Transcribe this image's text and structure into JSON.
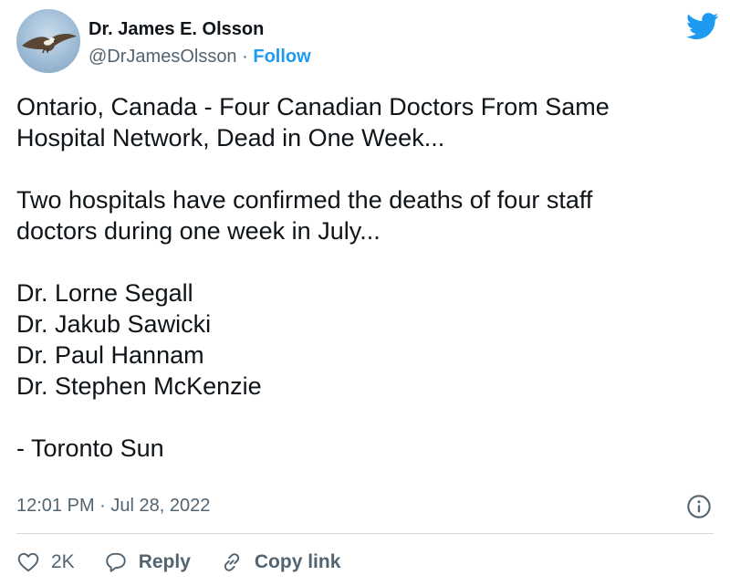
{
  "author": {
    "display_name": "Dr. James E. Olsson",
    "handle": "@DrJamesOlsson",
    "separator": "·",
    "follow_label": "Follow"
  },
  "tweet": {
    "lines": [
      "Ontario, Canada - Four Canadian Doctors From Same",
      "Hospital Network, Dead in One Week...",
      "Two hospitals have confirmed the deaths of four staff",
      "doctors during one week in July...",
      "Dr. Lorne Segall",
      "Dr. Jakub Sawicki",
      "Dr. Paul Hannam",
      "Dr. Stephen McKenzie",
      "- Toronto Sun"
    ]
  },
  "meta": {
    "time": "12:01 PM",
    "separator": "·",
    "date": "Jul 28, 2022"
  },
  "actions": {
    "like_count": "2K",
    "reply_label": "Reply",
    "copy_link_label": "Copy link"
  },
  "colors": {
    "accent": "#1d9bf0",
    "text": "#0f1419",
    "secondary": "#536471",
    "divider": "#cfd9de"
  },
  "icons": {
    "logo": "twitter-bird-icon",
    "info": "info-icon",
    "like": "heart-icon",
    "reply": "reply-bubble-icon",
    "copy": "link-icon"
  }
}
